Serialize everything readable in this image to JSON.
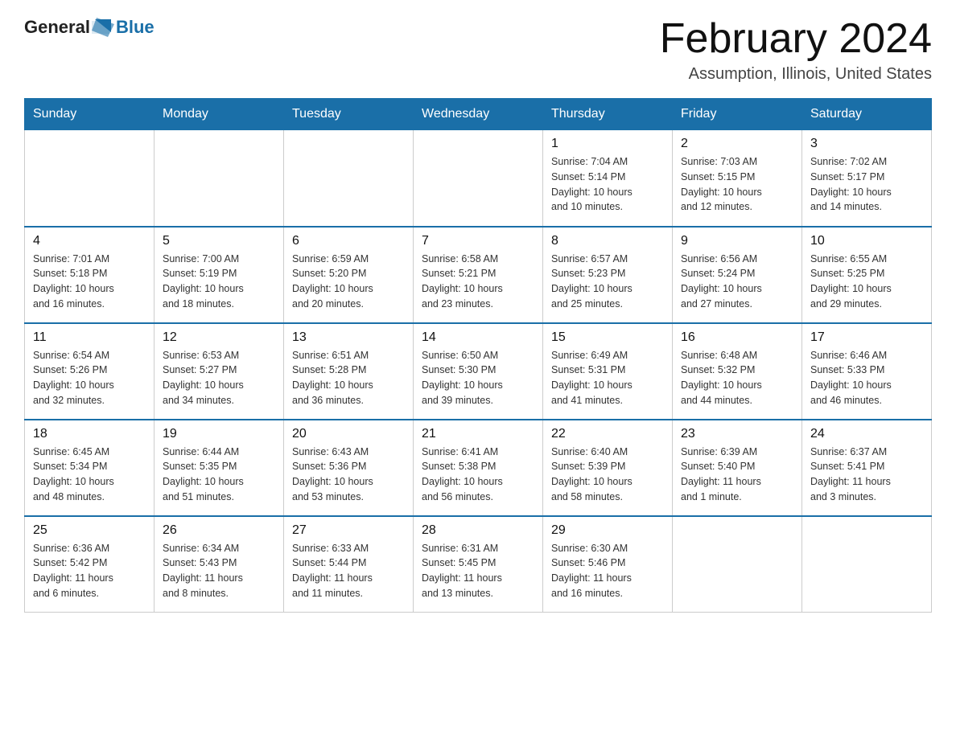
{
  "logo": {
    "text_general": "General",
    "text_blue": "Blue"
  },
  "header": {
    "month_title": "February 2024",
    "subtitle": "Assumption, Illinois, United States"
  },
  "weekdays": [
    "Sunday",
    "Monday",
    "Tuesday",
    "Wednesday",
    "Thursday",
    "Friday",
    "Saturday"
  ],
  "weeks": [
    [
      {
        "day": "",
        "info": ""
      },
      {
        "day": "",
        "info": ""
      },
      {
        "day": "",
        "info": ""
      },
      {
        "day": "",
        "info": ""
      },
      {
        "day": "1",
        "info": "Sunrise: 7:04 AM\nSunset: 5:14 PM\nDaylight: 10 hours\nand 10 minutes."
      },
      {
        "day": "2",
        "info": "Sunrise: 7:03 AM\nSunset: 5:15 PM\nDaylight: 10 hours\nand 12 minutes."
      },
      {
        "day": "3",
        "info": "Sunrise: 7:02 AM\nSunset: 5:17 PM\nDaylight: 10 hours\nand 14 minutes."
      }
    ],
    [
      {
        "day": "4",
        "info": "Sunrise: 7:01 AM\nSunset: 5:18 PM\nDaylight: 10 hours\nand 16 minutes."
      },
      {
        "day": "5",
        "info": "Sunrise: 7:00 AM\nSunset: 5:19 PM\nDaylight: 10 hours\nand 18 minutes."
      },
      {
        "day": "6",
        "info": "Sunrise: 6:59 AM\nSunset: 5:20 PM\nDaylight: 10 hours\nand 20 minutes."
      },
      {
        "day": "7",
        "info": "Sunrise: 6:58 AM\nSunset: 5:21 PM\nDaylight: 10 hours\nand 23 minutes."
      },
      {
        "day": "8",
        "info": "Sunrise: 6:57 AM\nSunset: 5:23 PM\nDaylight: 10 hours\nand 25 minutes."
      },
      {
        "day": "9",
        "info": "Sunrise: 6:56 AM\nSunset: 5:24 PM\nDaylight: 10 hours\nand 27 minutes."
      },
      {
        "day": "10",
        "info": "Sunrise: 6:55 AM\nSunset: 5:25 PM\nDaylight: 10 hours\nand 29 minutes."
      }
    ],
    [
      {
        "day": "11",
        "info": "Sunrise: 6:54 AM\nSunset: 5:26 PM\nDaylight: 10 hours\nand 32 minutes."
      },
      {
        "day": "12",
        "info": "Sunrise: 6:53 AM\nSunset: 5:27 PM\nDaylight: 10 hours\nand 34 minutes."
      },
      {
        "day": "13",
        "info": "Sunrise: 6:51 AM\nSunset: 5:28 PM\nDaylight: 10 hours\nand 36 minutes."
      },
      {
        "day": "14",
        "info": "Sunrise: 6:50 AM\nSunset: 5:30 PM\nDaylight: 10 hours\nand 39 minutes."
      },
      {
        "day": "15",
        "info": "Sunrise: 6:49 AM\nSunset: 5:31 PM\nDaylight: 10 hours\nand 41 minutes."
      },
      {
        "day": "16",
        "info": "Sunrise: 6:48 AM\nSunset: 5:32 PM\nDaylight: 10 hours\nand 44 minutes."
      },
      {
        "day": "17",
        "info": "Sunrise: 6:46 AM\nSunset: 5:33 PM\nDaylight: 10 hours\nand 46 minutes."
      }
    ],
    [
      {
        "day": "18",
        "info": "Sunrise: 6:45 AM\nSunset: 5:34 PM\nDaylight: 10 hours\nand 48 minutes."
      },
      {
        "day": "19",
        "info": "Sunrise: 6:44 AM\nSunset: 5:35 PM\nDaylight: 10 hours\nand 51 minutes."
      },
      {
        "day": "20",
        "info": "Sunrise: 6:43 AM\nSunset: 5:36 PM\nDaylight: 10 hours\nand 53 minutes."
      },
      {
        "day": "21",
        "info": "Sunrise: 6:41 AM\nSunset: 5:38 PM\nDaylight: 10 hours\nand 56 minutes."
      },
      {
        "day": "22",
        "info": "Sunrise: 6:40 AM\nSunset: 5:39 PM\nDaylight: 10 hours\nand 58 minutes."
      },
      {
        "day": "23",
        "info": "Sunrise: 6:39 AM\nSunset: 5:40 PM\nDaylight: 11 hours\nand 1 minute."
      },
      {
        "day": "24",
        "info": "Sunrise: 6:37 AM\nSunset: 5:41 PM\nDaylight: 11 hours\nand 3 minutes."
      }
    ],
    [
      {
        "day": "25",
        "info": "Sunrise: 6:36 AM\nSunset: 5:42 PM\nDaylight: 11 hours\nand 6 minutes."
      },
      {
        "day": "26",
        "info": "Sunrise: 6:34 AM\nSunset: 5:43 PM\nDaylight: 11 hours\nand 8 minutes."
      },
      {
        "day": "27",
        "info": "Sunrise: 6:33 AM\nSunset: 5:44 PM\nDaylight: 11 hours\nand 11 minutes."
      },
      {
        "day": "28",
        "info": "Sunrise: 6:31 AM\nSunset: 5:45 PM\nDaylight: 11 hours\nand 13 minutes."
      },
      {
        "day": "29",
        "info": "Sunrise: 6:30 AM\nSunset: 5:46 PM\nDaylight: 11 hours\nand 16 minutes."
      },
      {
        "day": "",
        "info": ""
      },
      {
        "day": "",
        "info": ""
      }
    ]
  ]
}
